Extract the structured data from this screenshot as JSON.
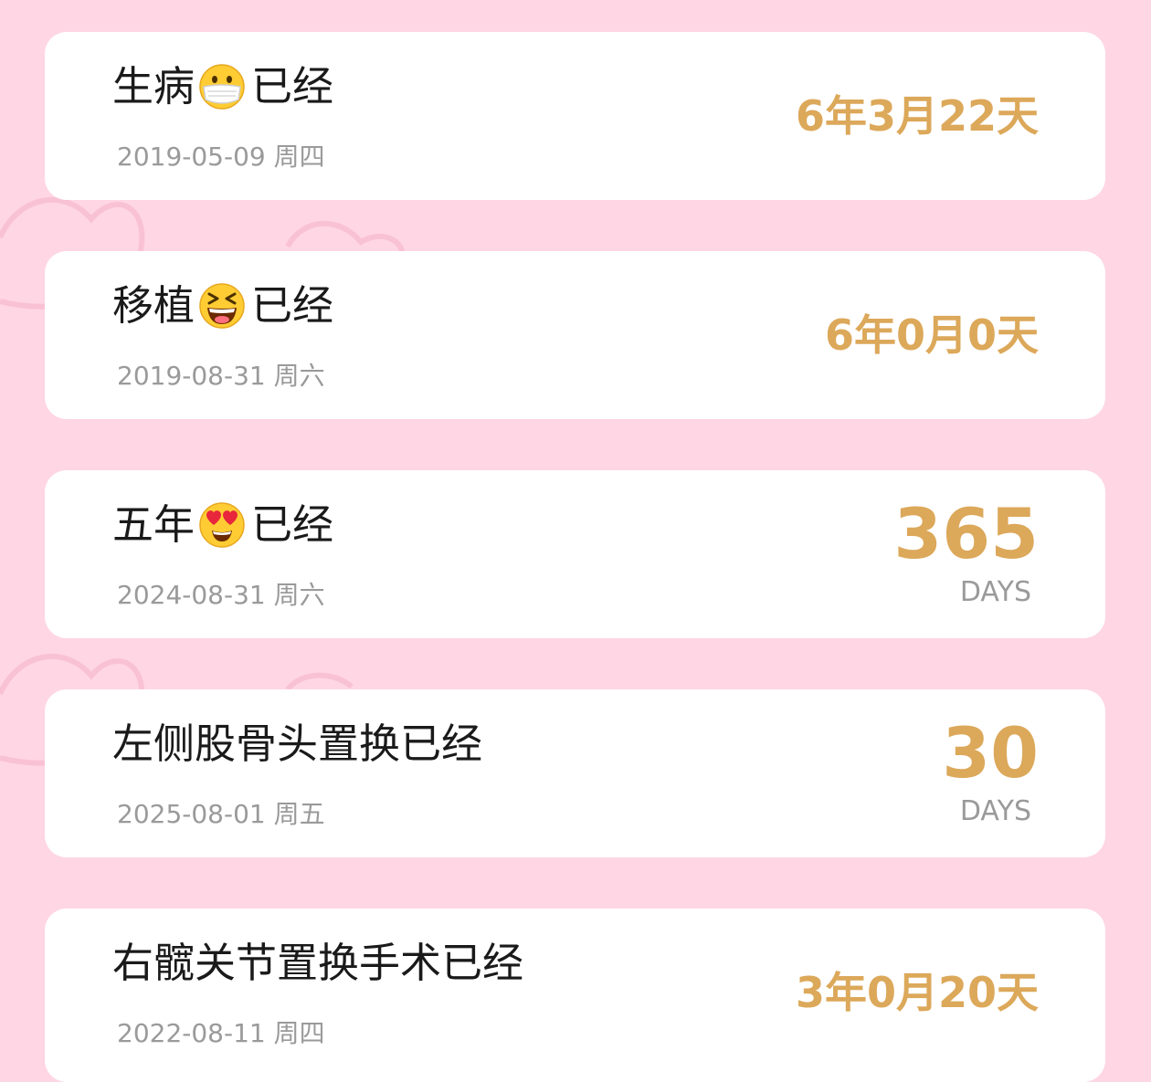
{
  "colors": {
    "background": "#ffd6e4",
    "card": "#ffffff",
    "accent": "#dca85a",
    "title_text": "#1a1a1a",
    "secondary_text": "#9a9a9a"
  },
  "cards": [
    {
      "title_prefix": "生病",
      "emoji": "face-with-medical-mask-icon",
      "title_suffix": "已经",
      "date": "2019-05-09 周四",
      "elapsed": "6年3月22天"
    },
    {
      "title_prefix": "移植",
      "emoji": "grinning-squinting-face-icon",
      "title_suffix": "已经",
      "date": "2019-08-31 周六",
      "elapsed": "6年0月0天"
    },
    {
      "title_prefix": "五年",
      "emoji": "heart-eyes-face-icon",
      "title_suffix": "已经",
      "date": "2024-08-31 周六",
      "days": "365",
      "days_label": "DAYS"
    },
    {
      "title": "左侧股骨头置换已经",
      "date": "2025-08-01 周五",
      "days": "30",
      "days_label": "DAYS"
    },
    {
      "title": "右髋关节置换手术已经",
      "date": "2022-08-11 周四",
      "elapsed": "3年0月20天"
    }
  ]
}
